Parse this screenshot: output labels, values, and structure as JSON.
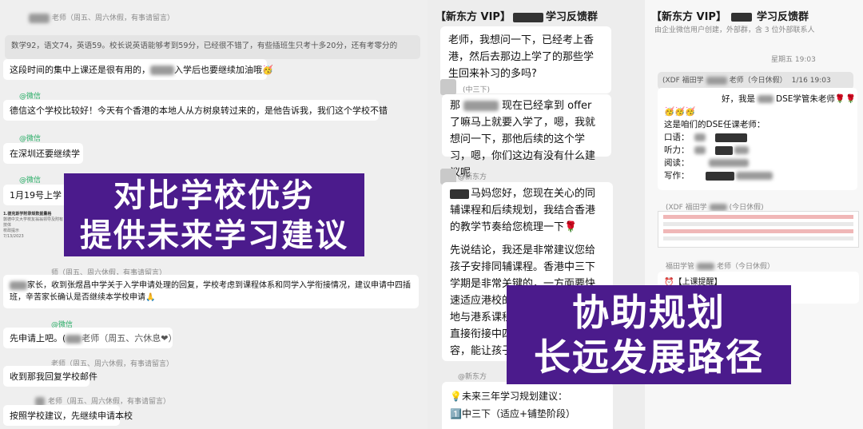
{
  "left_panel": {
    "quote_top_sender": "老师（周五、周六休假，有事请留言）",
    "quote_scores": "数学92，语文74，英语59。校长说英语能够考到59分，已经很不错了，有些插班生只考十多20分，还有考零分的",
    "msg_intensive": "这段时间的集中上课还是很有用的，",
    "msg_intensive_tail": "入学后也要继续加油哦🥳",
    "wechat_label": "@微信",
    "msg_deqiang": "德信这个学校比较好！今天有个香港的本地人从方树泉转过来的，是他告诉我，我们这个学校不错",
    "msg_shenzhen": "在深圳还要继续学",
    "msg_jan19": "1月19号上学",
    "doc_line1": "1.德克斯学附录规数据量格",
    "doc_line2": "敦德中文大学校友翁翁领导及附有技体",
    "doc_line3": "校政提示",
    "doc_line4": "7/13/2023",
    "sender_holiday": "师（周五、周六休假，有事请留言）",
    "msg_parent": "家长，收到张煜昌中学关于入学申请处理的回复，学校考虑到课程体系和同学入学衔接情况，建议申请中四插班，辛苦家长确认是否继续本学校申请🙏",
    "msg_apply_first": "先申请上吧。(",
    "msg_apply_teacher": "老师（周五、六休息❤）",
    "sender_holiday2": "老师（周五、周六休假，有事请留言）",
    "msg_receive": "收到那我回复学校邮件",
    "sender_holiday3": "老师（周五、周六休假，有事请留言）",
    "msg_follow": "按照学校建议，先继续申请本校",
    "overlay_line1": "对比学校优劣",
    "overlay_line2": "提供未来学习建议"
  },
  "middle_panel": {
    "title_prefix": "【新东方 VIP】",
    "title_suffix": "学习反馈群",
    "bubble1": "老师，我想问一下，已经考上香港，然后去那边上学了的那些学生回来补习的多吗?",
    "sender_grade": "(中三下)",
    "bubble2_a": "那",
    "bubble2_b": "现在已经拿到 offer 了嘛马上就要入学了，嗯，我就想问一下，那他后续的这个学习，嗯，你们这边有没有什么建议呢",
    "sender_xdf": "@新东方",
    "bubble3_head": "马妈您好，您现在关心的同辅课程和后续规划，我结合香港的教学节奏给您梳理一下🌹",
    "bubble3_body": "先说结论，我还是非常建议您给孩子安排同辅课程。香港中三下学期是非常关键的，一方面要快速适应港校的授课节奏，补上内地与港系课程的知识点，三下会直接衔接中四，提前通过同辅，容，能让孩子，的优势科目～",
    "sender_xdf2": "@新东方",
    "bubble4_l1": "💡未来三年学习规划建议：",
    "bubble4_l2": "1️⃣中三下（适应+铺垫阶段）",
    "overlay_line1": "协助规划",
    "overlay_line2": "长远发展路径"
  },
  "right_panel": {
    "title_prefix": "【新东方 VIP】",
    "title_suffix": "学习反馈群",
    "subtitle": "由企业微信用户创建，外部群，含 3 位外部联系人",
    "time": "星期五 19:03",
    "quote_sender": "(XDF 福田学",
    "quote_teacher": "老师（今日休假）",
    "quote_time": "1/16 19:03",
    "greet": "好，我是",
    "greet_tail": "DSE学管朱老师🌹🌹",
    "emoji": "🥳🥳🥳",
    "teachers_intro": "这是咱们的DSE任课老师：",
    "oral": "口语：",
    "listening": "听力：",
    "reading": "阅读：",
    "writing": "写作：",
    "sender2_a": "(XDF 福田学",
    "sender2_b": "(今日休假)",
    "sender3_a": "福田学管",
    "sender3_b": "老师（今日休假）",
    "reminder": "【上课提醒】"
  }
}
